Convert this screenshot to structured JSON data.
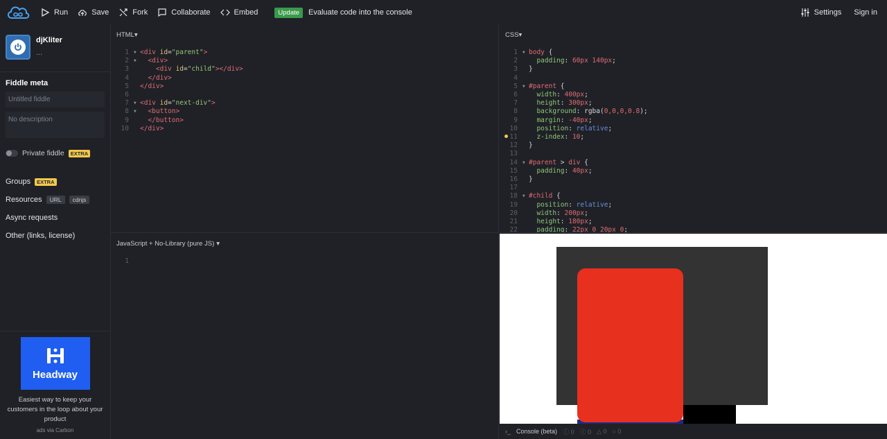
{
  "topbar": {
    "run": "Run",
    "save": "Save",
    "fork": "Fork",
    "collaborate": "Collaborate",
    "embed": "Embed",
    "update_badge": "Update",
    "update_note": "Evaluate code into the console",
    "settings": "Settings",
    "signin": "Sign in"
  },
  "sidebar": {
    "user_name": "djKliter",
    "user_sub": "...",
    "meta_title": "Fiddle meta",
    "title_placeholder": "Untitled fiddle",
    "desc_placeholder": "No description",
    "private_label": "Private fiddle",
    "extra_badge": "EXTRA",
    "groups": "Groups",
    "resources": "Resources",
    "res_url": "URL",
    "res_cdnjs": "cdnjs",
    "async": "Async requests",
    "other": "Other (links, license)"
  },
  "ad": {
    "brand": "Headway",
    "text": "Easiest way to keep your customers in the loop about your product",
    "via": "ads via Carbon"
  },
  "panes": {
    "html_label": "HTML",
    "css_label": "CSS",
    "js_label": "JavaScript + No-Library (pure JS)"
  },
  "html_code": [
    {
      "n": "1",
      "f": "▾",
      "t": [
        [
          "tag",
          "<div "
        ],
        [
          "attr",
          "id"
        ],
        [
          "plain",
          "="
        ],
        [
          "str",
          "\"parent\""
        ],
        [
          "tag",
          ">"
        ]
      ]
    },
    {
      "n": "2",
      "f": "▾",
      "t": [
        [
          "plain",
          "  "
        ],
        [
          "tag",
          "<div>"
        ]
      ]
    },
    {
      "n": "3",
      "f": "",
      "t": [
        [
          "plain",
          "    "
        ],
        [
          "tag",
          "<div "
        ],
        [
          "attr",
          "id"
        ],
        [
          "plain",
          "="
        ],
        [
          "str",
          "\"child\""
        ],
        [
          "tag",
          "></div>"
        ]
      ]
    },
    {
      "n": "4",
      "f": "",
      "t": [
        [
          "plain",
          "  "
        ],
        [
          "tag",
          "</div>"
        ]
      ]
    },
    {
      "n": "5",
      "f": "",
      "t": [
        [
          "tag",
          "</div>"
        ]
      ]
    },
    {
      "n": "6",
      "f": "",
      "t": [
        [
          "plain",
          " "
        ]
      ]
    },
    {
      "n": "7",
      "f": "▾",
      "t": [
        [
          "tag",
          "<div "
        ],
        [
          "attr",
          "id"
        ],
        [
          "plain",
          "="
        ],
        [
          "str",
          "\"next-div\""
        ],
        [
          "tag",
          ">"
        ]
      ]
    },
    {
      "n": "8",
      "f": "▾",
      "t": [
        [
          "plain",
          "  "
        ],
        [
          "tag",
          "<button>"
        ]
      ]
    },
    {
      "n": "9",
      "f": "",
      "t": [
        [
          "plain",
          "  "
        ],
        [
          "tag",
          "</button>"
        ]
      ]
    },
    {
      "n": "10",
      "f": "",
      "t": [
        [
          "tag",
          "</div>"
        ]
      ]
    }
  ],
  "css_code": [
    {
      "n": "1",
      "f": "▾",
      "t": [
        [
          "sel",
          "body "
        ],
        [
          "plain",
          "{"
        ]
      ]
    },
    {
      "n": "2",
      "f": "",
      "t": [
        [
          "plain",
          "  "
        ],
        [
          "prop",
          "padding"
        ],
        [
          "plain",
          ": "
        ],
        [
          "val",
          "60px 140px"
        ],
        [
          "plain",
          ";"
        ]
      ]
    },
    {
      "n": "3",
      "f": "",
      "t": [
        [
          "plain",
          "}"
        ]
      ]
    },
    {
      "n": "4",
      "f": "",
      "t": [
        [
          "plain",
          " "
        ]
      ]
    },
    {
      "n": "5",
      "f": "▾",
      "t": [
        [
          "sel",
          "#parent "
        ],
        [
          "plain",
          "{"
        ]
      ]
    },
    {
      "n": "6",
      "f": "",
      "t": [
        [
          "plain",
          "  "
        ],
        [
          "prop",
          "width"
        ],
        [
          "plain",
          ": "
        ],
        [
          "val",
          "400px"
        ],
        [
          "plain",
          ";"
        ]
      ]
    },
    {
      "n": "7",
      "f": "",
      "t": [
        [
          "plain",
          "  "
        ],
        [
          "prop",
          "height"
        ],
        [
          "plain",
          ": "
        ],
        [
          "val",
          "300px"
        ],
        [
          "plain",
          ";"
        ]
      ]
    },
    {
      "n": "8",
      "f": "",
      "t": [
        [
          "plain",
          "  "
        ],
        [
          "prop",
          "background"
        ],
        [
          "plain",
          ": rgba("
        ],
        [
          "val",
          "0,0,0,0.8"
        ],
        [
          "plain",
          ");"
        ]
      ]
    },
    {
      "n": "9",
      "f": "",
      "t": [
        [
          "plain",
          "  "
        ],
        [
          "prop",
          "margin"
        ],
        [
          "plain",
          ": "
        ],
        [
          "val",
          "-40px"
        ],
        [
          "plain",
          ";"
        ]
      ]
    },
    {
      "n": "10",
      "f": "",
      "t": [
        [
          "plain",
          "  "
        ],
        [
          "prop",
          "position"
        ],
        [
          "plain",
          ": "
        ],
        [
          "kw",
          "relative"
        ],
        [
          "plain",
          ";"
        ]
      ]
    },
    {
      "n": "11",
      "f": "",
      "t": [
        [
          "plain",
          "  "
        ],
        [
          "prop",
          "z-index"
        ],
        [
          "plain",
          ": "
        ],
        [
          "val",
          "10"
        ],
        [
          "plain",
          ";"
        ]
      ]
    },
    {
      "n": "12",
      "f": "",
      "t": [
        [
          "plain",
          "}"
        ]
      ]
    },
    {
      "n": "13",
      "f": "",
      "t": [
        [
          "plain",
          " "
        ]
      ]
    },
    {
      "n": "14",
      "f": "▾",
      "t": [
        [
          "sel",
          "#parent "
        ],
        [
          "plain",
          "> "
        ],
        [
          "sel",
          "div "
        ],
        [
          "plain",
          "{"
        ]
      ]
    },
    {
      "n": "15",
      "f": "",
      "t": [
        [
          "plain",
          "  "
        ],
        [
          "prop",
          "padding"
        ],
        [
          "plain",
          ": "
        ],
        [
          "val",
          "40px"
        ],
        [
          "plain",
          ";"
        ]
      ]
    },
    {
      "n": "16",
      "f": "",
      "t": [
        [
          "plain",
          "}"
        ]
      ]
    },
    {
      "n": "17",
      "f": "",
      "t": [
        [
          "plain",
          " "
        ]
      ]
    },
    {
      "n": "18",
      "f": "▾",
      "t": [
        [
          "sel",
          "#child "
        ],
        [
          "plain",
          "{"
        ]
      ]
    },
    {
      "n": "19",
      "f": "",
      "t": [
        [
          "plain",
          "  "
        ],
        [
          "prop",
          "position"
        ],
        [
          "plain",
          ": "
        ],
        [
          "kw",
          "relative"
        ],
        [
          "plain",
          ";"
        ]
      ]
    },
    {
      "n": "20",
      "f": "",
      "t": [
        [
          "plain",
          "  "
        ],
        [
          "prop",
          "width"
        ],
        [
          "plain",
          ": "
        ],
        [
          "val",
          "200px"
        ],
        [
          "plain",
          ";"
        ]
      ]
    },
    {
      "n": "21",
      "f": "",
      "t": [
        [
          "plain",
          "  "
        ],
        [
          "prop",
          "height"
        ],
        [
          "plain",
          ": "
        ],
        [
          "val",
          "180px"
        ],
        [
          "plain",
          ";"
        ]
      ]
    },
    {
      "n": "22",
      "f": "",
      "t": [
        [
          "plain",
          "  "
        ],
        [
          "prop",
          "padding"
        ],
        [
          "plain",
          ": "
        ],
        [
          "val",
          "22px 0 20px 0"
        ],
        [
          "plain",
          ";"
        ]
      ]
    }
  ],
  "js_code": [
    {
      "n": "1",
      "f": "",
      "t": [
        [
          "plain",
          " "
        ]
      ]
    }
  ],
  "console": {
    "label": "Console (beta)",
    "counts": [
      "0",
      "0",
      "0",
      "0"
    ]
  }
}
